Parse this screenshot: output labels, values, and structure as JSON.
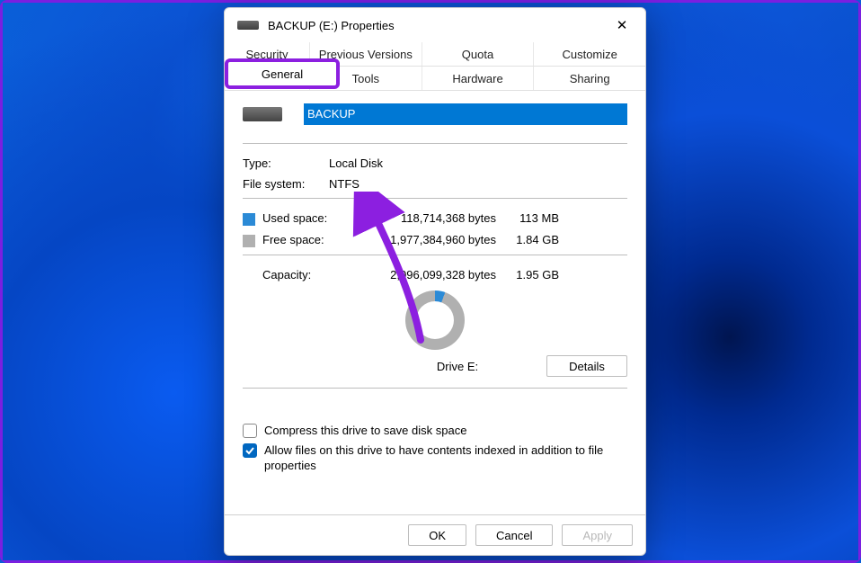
{
  "window": {
    "title": "BACKUP (E:) Properties"
  },
  "tabs_row1": [
    "Security",
    "Previous Versions",
    "Quota",
    "Customize"
  ],
  "tabs_row2": [
    "General",
    "Tools",
    "Hardware",
    "Sharing"
  ],
  "highlight_tab": "General",
  "drive_name": "BACKUP",
  "info": {
    "type_label": "Type:",
    "type_value": "Local Disk",
    "fs_label": "File system:",
    "fs_value": "NTFS"
  },
  "space": {
    "used_label": "Used space:",
    "used_bytes": "118,714,368 bytes",
    "used_human": "113 MB",
    "free_label": "Free space:",
    "free_bytes": "1,977,384,960 bytes",
    "free_human": "1.84 GB",
    "cap_label": "Capacity:",
    "cap_bytes": "2,096,099,328 bytes",
    "cap_human": "1.95 GB"
  },
  "drive_label": "Drive E:",
  "buttons": {
    "details": "Details",
    "ok": "OK",
    "cancel": "Cancel",
    "apply": "Apply"
  },
  "checkboxes": {
    "compress": "Compress this drive to save disk space",
    "index": "Allow files on this drive to have contents indexed in addition to file properties"
  }
}
